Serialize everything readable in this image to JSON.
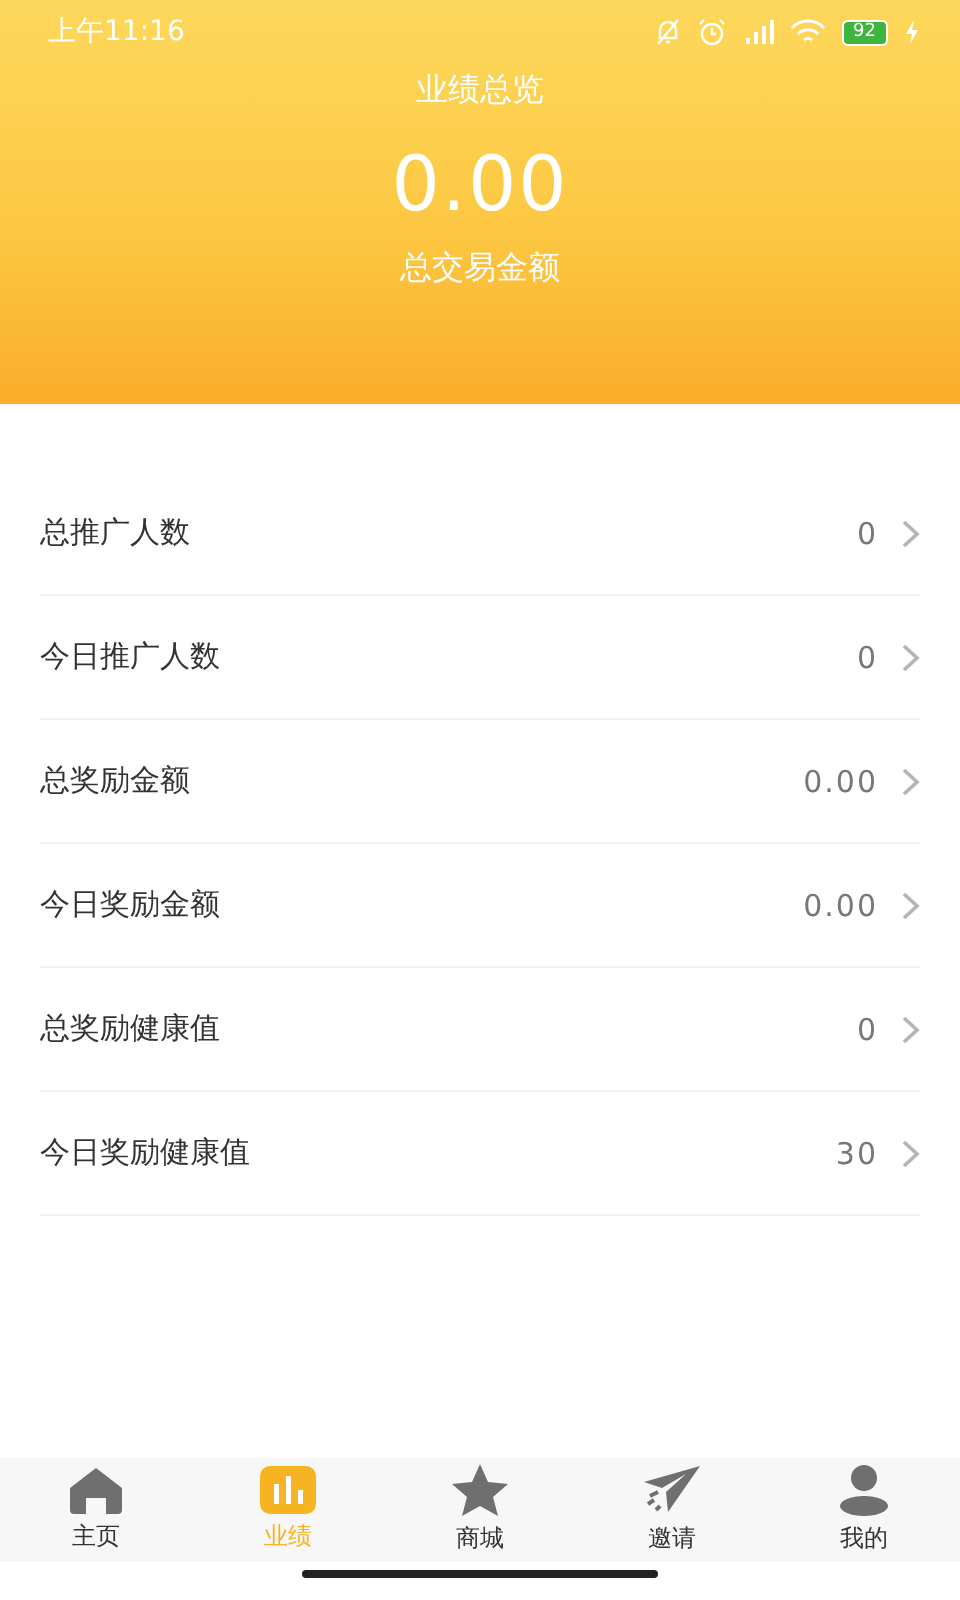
{
  "status_bar": {
    "time": "上午11:16",
    "battery": "92"
  },
  "header": {
    "title": "业绩总览",
    "amount": "0.00",
    "caption": "总交易金额"
  },
  "rows": [
    {
      "label": "总推广人数",
      "value": "0"
    },
    {
      "label": "今日推广人数",
      "value": "0"
    },
    {
      "label": "总奖励金额",
      "value": "0.00"
    },
    {
      "label": "今日奖励金额",
      "value": "0.00"
    },
    {
      "label": "总奖励健康值",
      "value": "0"
    },
    {
      "label": "今日奖励健康值",
      "value": "30"
    }
  ],
  "tabs": [
    {
      "label": "主页",
      "kind": "home",
      "selected": false
    },
    {
      "label": "业绩",
      "kind": "chart",
      "selected": true
    },
    {
      "label": "商城",
      "kind": "star",
      "selected": false
    },
    {
      "label": "邀请",
      "kind": "plane",
      "selected": false
    },
    {
      "label": "我的",
      "kind": "person",
      "selected": false
    }
  ]
}
